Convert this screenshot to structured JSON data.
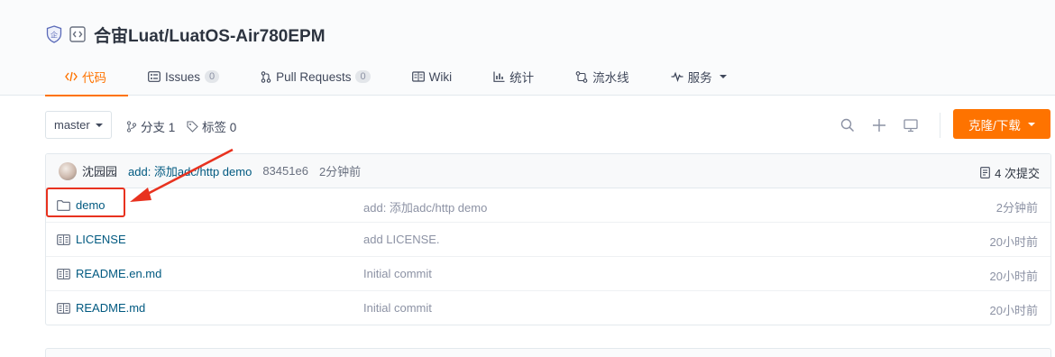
{
  "repo": {
    "owner_repo": "合宙Luat/LuatOS-Air780EPM"
  },
  "tabs": [
    {
      "label": "代码",
      "icon": "code-icon",
      "active": true
    },
    {
      "label": "Issues",
      "icon": "issues-icon",
      "badge": "0"
    },
    {
      "label": "Pull Requests",
      "icon": "pull-request-icon",
      "badge": "0"
    },
    {
      "label": "Wiki",
      "icon": "book-icon"
    },
    {
      "label": "统计",
      "icon": "chart-icon"
    },
    {
      "label": "流水线",
      "icon": "pipeline-icon"
    },
    {
      "label": "服务",
      "icon": "pulse-icon"
    }
  ],
  "toolbar": {
    "branch": "master",
    "branches_label": "分支 1",
    "tags_label": "标签 0",
    "clone_label": "克隆/下载"
  },
  "commit": {
    "author": "沈园园",
    "message": "add: 添加adc/http demo",
    "sha": "83451e6",
    "time": "2分钟前",
    "count_label": "4 次提交"
  },
  "files": [
    {
      "name": "demo",
      "type": "folder",
      "message": "add: 添加adc/http demo",
      "time": "2分钟前"
    },
    {
      "name": "LICENSE",
      "type": "file",
      "message": "add LICENSE.",
      "time": "20小时前"
    },
    {
      "name": "README.en.md",
      "type": "file",
      "message": "Initial commit",
      "time": "20小时前"
    },
    {
      "name": "README.md",
      "type": "file",
      "message": "Initial commit",
      "time": "20小时前"
    }
  ],
  "colors": {
    "accent": "#fe7300",
    "link": "#005980",
    "annotation": "#e8321f"
  }
}
